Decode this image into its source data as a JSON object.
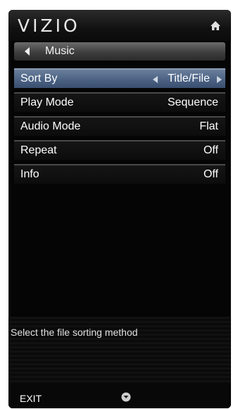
{
  "brand": {
    "logo_text": "VIZIO"
  },
  "icons": {
    "home": "home-icon",
    "back": "chevron-left-icon",
    "down": "chevron-down-circle-icon"
  },
  "submenu": {
    "title": "Music"
  },
  "menu": {
    "items": [
      {
        "label": "Sort By",
        "value": "Title/File",
        "selected": true
      },
      {
        "label": "Play Mode",
        "value": "Sequence",
        "selected": false
      },
      {
        "label": "Audio Mode",
        "value": "Flat",
        "selected": false
      },
      {
        "label": "Repeat",
        "value": "Off",
        "selected": false
      },
      {
        "label": "Info",
        "value": "Off",
        "selected": false
      }
    ]
  },
  "help": {
    "text": "Select the file sorting method"
  },
  "footer": {
    "exit_label": "EXIT"
  },
  "colors": {
    "selected_row": "#4b6284",
    "background": "#050505",
    "text": "#ffffff"
  }
}
